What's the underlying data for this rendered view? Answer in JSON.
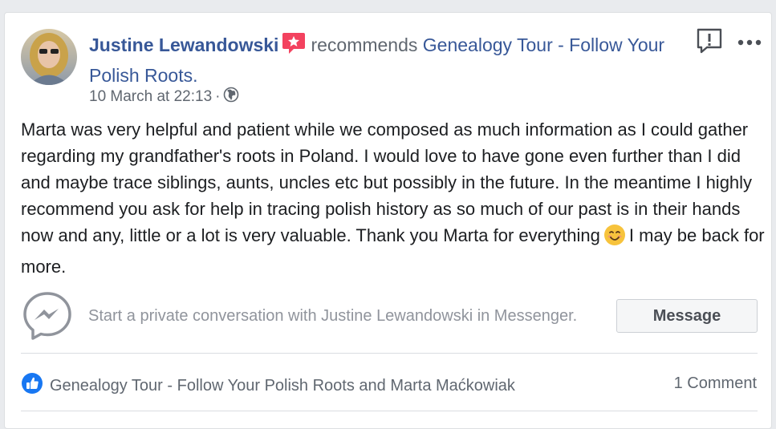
{
  "post": {
    "author": "Justine Lewandowski",
    "verb": "recommends",
    "page_name": "Genealogy Tour - Follow Your Polish Roots.",
    "date": "10 March at 22:13",
    "separator": "·",
    "audience_icon": "globe-icon",
    "text_part1": "Marta was very helpful and patient while we composed as much information as I could gather regarding my grandfather's roots in Poland. I would love to have gone even further than I did and maybe trace siblings, aunts, uncles etc but possibly in the future. In the meantime I highly recommend you ask for help in tracing polish history as so much of our past is in their hands now and any, little or a lot is very valuable. Thank you Marta for everything",
    "emoji": "smiling-face-icon",
    "text_part2": "I may be back for more."
  },
  "messenger": {
    "prompt": "Start a private conversation with Justine Lewandowski in Messenger.",
    "button_label": "Message",
    "icon": "messenger-icon"
  },
  "footer": {
    "likes_text": "Genealogy Tour - Follow Your Polish Roots and Marta Maćkowiak",
    "comments": "1 Comment",
    "like_icon": "like-icon"
  },
  "colors": {
    "link": "#385898",
    "meta": "#606770",
    "text": "#1c1e21",
    "recommend_badge": "#f3425f",
    "like_blue": "#1877f2"
  }
}
